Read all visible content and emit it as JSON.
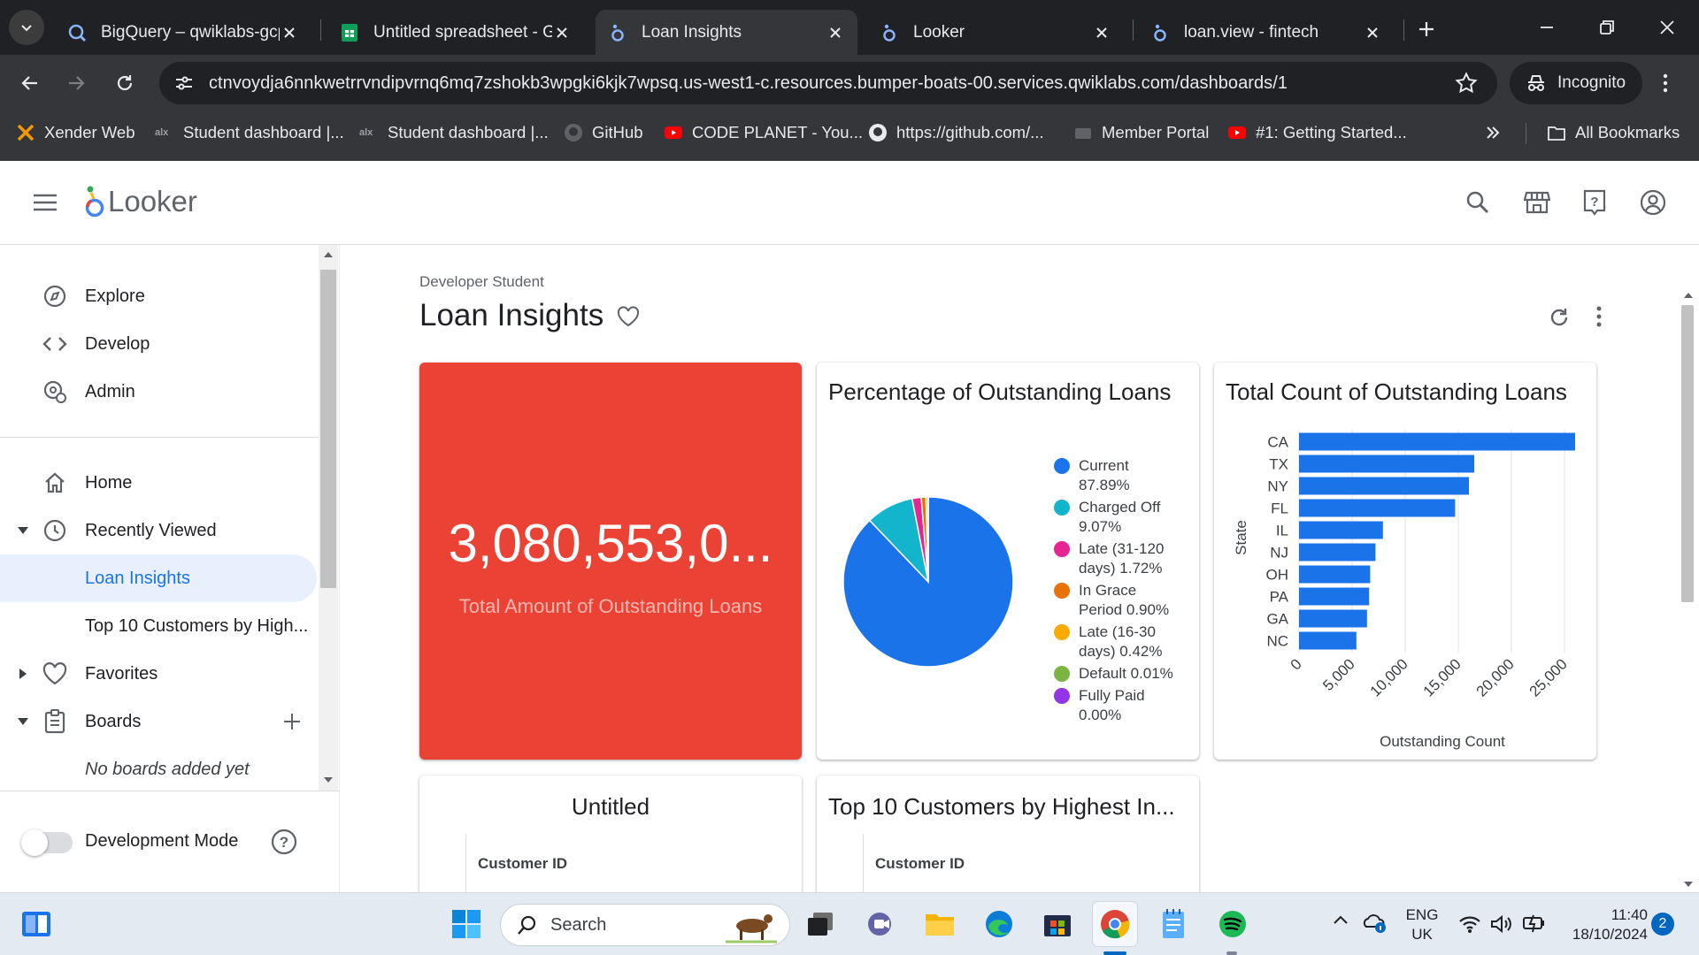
{
  "browser": {
    "tabs": [
      {
        "title": "BigQuery – qwiklabs-gcp",
        "icon": "bigquery-icon",
        "active": false
      },
      {
        "title": "Untitled spreadsheet - Go",
        "icon": "sheets-icon",
        "active": false
      },
      {
        "title": "Loan Insights",
        "icon": "looker-icon",
        "active": true
      },
      {
        "title": "Looker",
        "icon": "looker-icon",
        "active": false
      },
      {
        "title": "loan.view - fintech",
        "icon": "looker-icon",
        "active": false
      }
    ],
    "url": "ctnvoydja6nnkwetrrvndipvrnq6mq7zshokb3wpgki6kjk7wpsq.us-west1-c.resources.bumper-boats-00.services.qwiklabs.com/dashboards/1",
    "incognito_label": "Incognito",
    "bookmarks": [
      {
        "label": "Xender Web",
        "icon": "xender-icon"
      },
      {
        "label": "Student dashboard |...",
        "icon": "alx-icon"
      },
      {
        "label": "Student dashboard |...",
        "icon": "alx-icon"
      },
      {
        "label": "GitHub",
        "icon": "github-icon"
      },
      {
        "label": "CODE PLANET - You...",
        "icon": "youtube-icon"
      },
      {
        "label": "https://github.com/...",
        "icon": "github-icon"
      },
      {
        "label": "Member Portal",
        "icon": "portal-icon"
      },
      {
        "label": "#1: Getting Started...",
        "icon": "youtube-icon"
      }
    ],
    "all_bookmarks_label": "All Bookmarks"
  },
  "looker": {
    "brand": "Looker",
    "nav_top": [
      {
        "label": "Explore",
        "icon": "explore-compass-icon"
      },
      {
        "label": "Develop",
        "icon": "code-brackets-icon"
      },
      {
        "label": "Admin",
        "icon": "admin-gear-icon"
      }
    ],
    "nav_home": "Home",
    "nav_recent": "Recently Viewed",
    "recent_items": [
      "Loan Insights",
      "Top 10 Customers by High..."
    ],
    "nav_favorites": "Favorites",
    "nav_boards": "Boards",
    "boards_empty": "No boards added yet",
    "dev_mode_label": "Development Mode"
  },
  "dashboard": {
    "folder": "Developer Student",
    "title": "Loan Insights",
    "kpi": {
      "value": "3,080,553,0...",
      "label": "Total Amount of Outstanding Loans",
      "color": "#ea4335"
    },
    "pie_title": "Percentage of Outstanding Loans",
    "bar_title": "Total Count of Outstanding Loans",
    "untitled_title": "Untitled",
    "top10_title": "Top 10 Customers by Highest In...",
    "col_customer_id": "Customer ID"
  },
  "chart_data": [
    {
      "type": "pie",
      "title": "Percentage of Outstanding Loans",
      "slices": [
        {
          "label": "Current",
          "pct_label": "87.89%",
          "value": 87.89,
          "color": "#1a73e8",
          "lines": [
            "Current",
            "87.89%"
          ]
        },
        {
          "label": "Charged Off",
          "pct_label": "9.07%",
          "value": 9.07,
          "color": "#12b5cb",
          "lines": [
            "Charged Off",
            "9.07%"
          ]
        },
        {
          "label": "Late (31-120 days)",
          "pct_label": "1.72%",
          "value": 1.72,
          "color": "#e52592",
          "lines": [
            "Late (31-120",
            "days) 1.72%"
          ]
        },
        {
          "label": "In Grace Period",
          "pct_label": "0.90%",
          "value": 0.9,
          "color": "#e8710a",
          "lines": [
            "In Grace",
            "Period 0.90%"
          ]
        },
        {
          "label": "Late (16-30 days)",
          "pct_label": "0.42%",
          "value": 0.42,
          "color": "#f9ab00",
          "lines": [
            "Late (16-30",
            "days) 0.42%"
          ]
        },
        {
          "label": "Default",
          "pct_label": "0.01%",
          "value": 0.01,
          "color": "#7cb342",
          "lines": [
            "Default 0.01%"
          ]
        },
        {
          "label": "Fully Paid",
          "pct_label": "0.00%",
          "value": 0.0,
          "color": "#9334e6",
          "lines": [
            "Fully Paid",
            "0.00%"
          ]
        }
      ]
    },
    {
      "type": "bar",
      "orientation": "horizontal",
      "title": "Total Count of Outstanding Loans",
      "categories": [
        "CA",
        "TX",
        "NY",
        "FL",
        "IL",
        "NJ",
        "OH",
        "PA",
        "GA",
        "NC"
      ],
      "values": [
        26000,
        16500,
        16000,
        14700,
        7900,
        7200,
        6700,
        6600,
        6400,
        5400
      ],
      "xlabel": "Outstanding Count",
      "ylabel": "State",
      "xlim": [
        0,
        27000
      ],
      "xticks": [
        "0",
        "5,000",
        "10,000",
        "15,000",
        "20,000",
        "25,000"
      ],
      "color": "#1a73e8",
      "grid": true
    }
  ],
  "taskbar": {
    "search_placeholder": "Search",
    "lang_top": "ENG",
    "lang_bottom": "UK",
    "time": "11:40",
    "date": "18/10/2024",
    "notification_count": "2"
  }
}
